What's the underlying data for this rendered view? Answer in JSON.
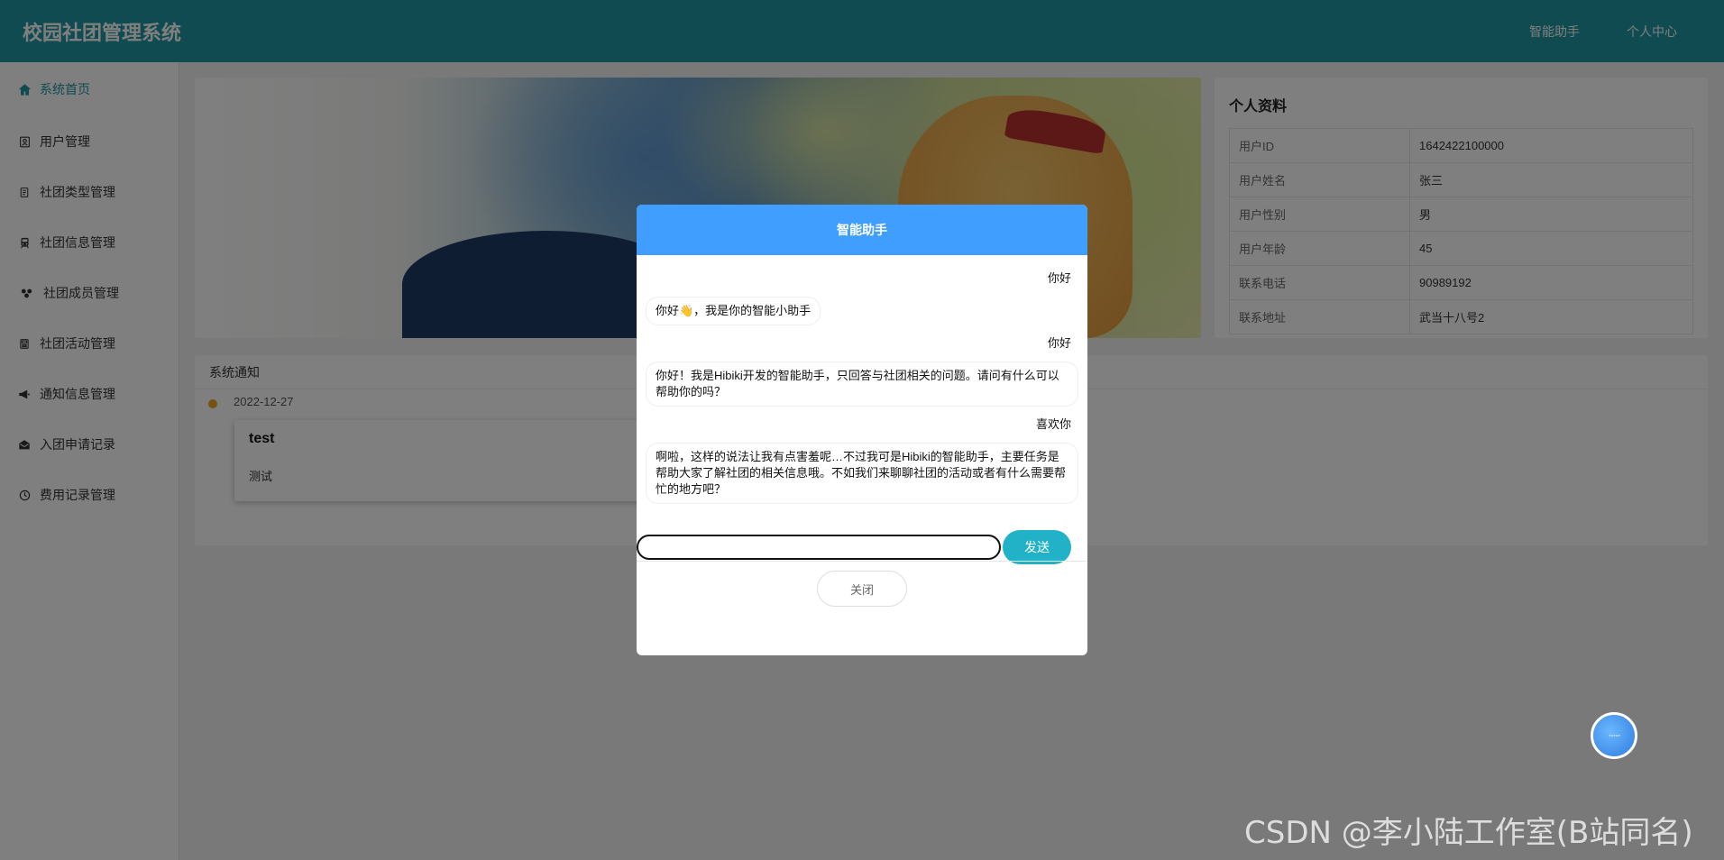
{
  "app": {
    "title": "校园社团管理系统",
    "nav": [
      {
        "label": "智能助手"
      },
      {
        "label": "个人中心"
      }
    ],
    "accent_color": "#1e96a0"
  },
  "sidebar": {
    "items": [
      {
        "label": "系统首页",
        "icon": "home-icon",
        "active": true
      },
      {
        "label": "用户管理",
        "icon": "user-card-icon"
      },
      {
        "label": "社团类型管理",
        "icon": "clipboard-icon"
      },
      {
        "label": "社团信息管理",
        "icon": "train-icon"
      },
      {
        "label": "社团成员管理",
        "icon": "group-icon"
      },
      {
        "label": "社团活动管理",
        "icon": "calculator-icon"
      },
      {
        "label": "通知信息管理",
        "icon": "megaphone-icon"
      },
      {
        "label": "入团申请记录",
        "icon": "envelope-icon"
      },
      {
        "label": "费用记录管理",
        "icon": "clock-icon"
      }
    ]
  },
  "profile": {
    "title": "个人资料",
    "rows": [
      {
        "key": "用户ID",
        "value": "1642422100000"
      },
      {
        "key": "用户姓名",
        "value": "张三"
      },
      {
        "key": "用户性别",
        "value": "男"
      },
      {
        "key": "用户年龄",
        "value": "45"
      },
      {
        "key": "联系电话",
        "value": "90989192"
      },
      {
        "key": "联系地址",
        "value": "武当十八号2"
      }
    ]
  },
  "notice": {
    "title": "系统通知",
    "date": "2022-12-27",
    "item_title": "test",
    "item_content": "测试"
  },
  "dialog": {
    "title": "智能助手",
    "messages": [
      {
        "role": "user",
        "text": "你好"
      },
      {
        "role": "bot",
        "text": "你好👋，我是你的智能小助手"
      },
      {
        "role": "user",
        "text": "你好"
      },
      {
        "role": "bot",
        "text": "你好！我是Hibiki开发的智能助手，只回答与社团相关的问题。请问有什么可以帮助你的吗？"
      },
      {
        "role": "user",
        "text": "喜欢你"
      },
      {
        "role": "bot",
        "text": "啊啦，这样的说法让我有点害羞呢…不过我可是Hibiki的智能助手，主要任务是帮助大家了解社团的相关信息哦。不如我们来聊聊社团的活动或者有什么需要帮忙的地方吧？"
      }
    ],
    "input_value": "",
    "send_label": "发送",
    "close_label": "关闭",
    "header_color": "#409eff"
  },
  "watermark": "CSDN @李小陆工作室(B站同名)"
}
